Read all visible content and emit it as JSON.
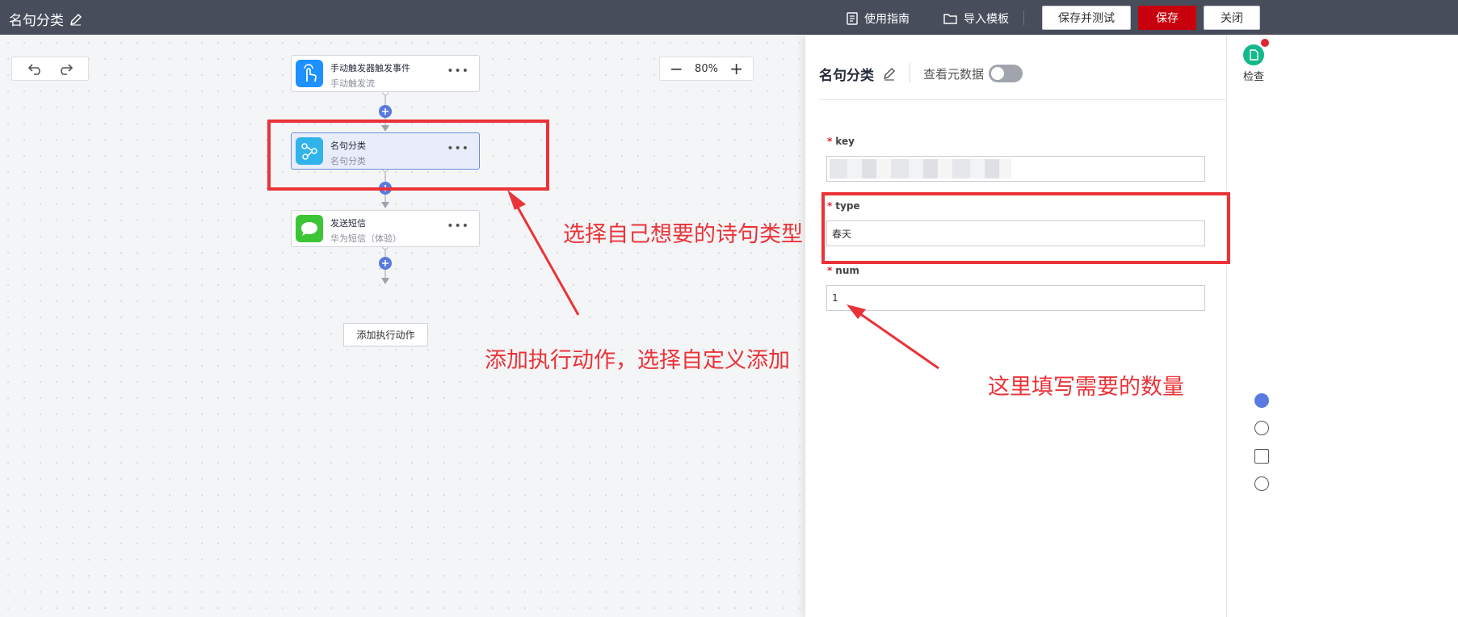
{
  "header": {
    "title": "名句分类",
    "guide_label": "使用指南",
    "import_label": "导入模板",
    "save_test_label": "保存并测试",
    "save_label": "保存",
    "close_label": "关闭"
  },
  "canvas": {
    "zoom_value": "80%",
    "nodes": [
      {
        "title": "手动触发器触发事件",
        "subtitle": "手动触发流",
        "icon": "hand-pointer-icon",
        "color": "#1e90ff"
      },
      {
        "title": "名句分类",
        "subtitle": "名句分类",
        "icon": "connector-icon",
        "color": "#30b3ea"
      },
      {
        "title": "发送短信",
        "subtitle": "华为短信（体验）",
        "icon": "message-bubble-icon",
        "color": "#3cc535"
      }
    ],
    "add_action_label": "添加执行动作"
  },
  "panel": {
    "title": "名句分类",
    "meta_label": "查看元数据",
    "fields": [
      {
        "label": "key",
        "value": ""
      },
      {
        "label": "type",
        "value": "春天"
      },
      {
        "label": "num",
        "value": "1"
      }
    ]
  },
  "side": {
    "check_label": "检查"
  },
  "annotations": {
    "type_note": "选择自己想要的诗句类型",
    "action_note": "添加执行动作，选择自定义添加",
    "num_note": "这里填写需要的数量",
    "color": "#ea3338"
  }
}
